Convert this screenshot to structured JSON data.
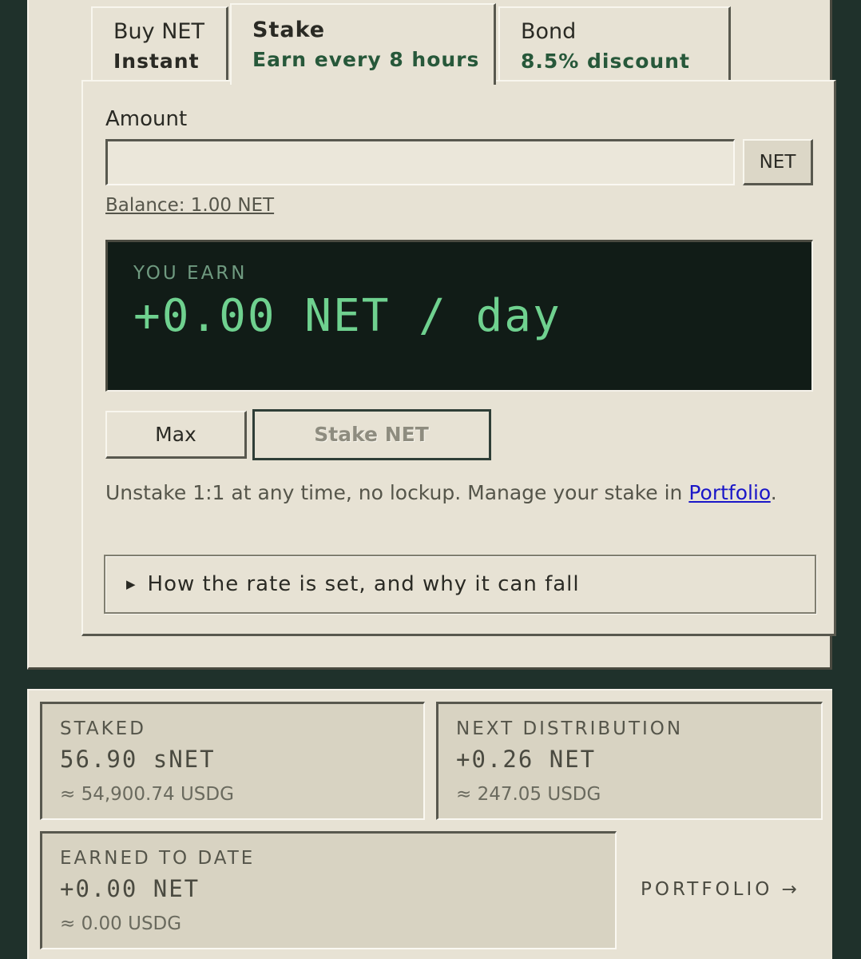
{
  "tabs": [
    {
      "title": "Buy NET",
      "subtitle": "Instant"
    },
    {
      "title": "Stake",
      "subtitle": "Earn every 8 hours"
    },
    {
      "title": "Bond",
      "subtitle": "8.5% discount"
    }
  ],
  "stake_form": {
    "amount_label": "Amount",
    "amount_value": "",
    "amount_placeholder": "",
    "unit": "NET",
    "balance": "Balance: 1.00 NET",
    "earn_label": "YOU EARN",
    "earn_value": "+0.00 NET / day",
    "max_label": "Max",
    "stake_label": "Stake NET",
    "note_text": "Unstake 1:1 at any time, no lockup. Manage your stake in ",
    "note_link": "Portfolio",
    "note_end": ".",
    "details_summary": "How the rate is set, and why it can fall"
  },
  "stats": {
    "staked": {
      "label": "STAKED",
      "value": "56.90 sNET",
      "sub": "≈ 54,900.74 USDG"
    },
    "next": {
      "label": "NEXT DISTRIBUTION",
      "value": "+0.26 NET",
      "sub": "≈ 247.05 USDG"
    },
    "earned": {
      "label": "EARNED TO DATE",
      "value": "+0.00 NET",
      "sub": "≈ 0.00 USDG"
    },
    "portfolio_link": "PORTFOLIO →"
  },
  "colors": {
    "background": "#1f312b",
    "panel": "#e7e2d4",
    "accent_green": "#27583a",
    "earn_text": "#6fd18f",
    "link": "#1a16c8"
  }
}
